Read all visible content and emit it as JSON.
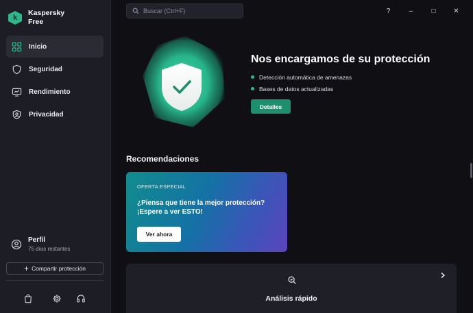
{
  "app": {
    "name": "Kaspersky Free",
    "logo_letter": "k",
    "brand_color": "#2fb68a"
  },
  "search": {
    "placeholder": "Buscar (Ctrl+F)"
  },
  "window_controls": {
    "help": "?",
    "minimize": "–",
    "maximize": "□",
    "close": "✕"
  },
  "sidebar": {
    "items": [
      {
        "label": "Inicio",
        "icon": "grid-icon",
        "active": true
      },
      {
        "label": "Seguridad",
        "icon": "shield-icon",
        "active": false
      },
      {
        "label": "Rendimiento",
        "icon": "monitor-icon",
        "active": false
      },
      {
        "label": "Privacidad",
        "icon": "privacy-shield-icon",
        "active": false
      }
    ],
    "profile": {
      "name": "Perfil",
      "subtitle": "75 días restantes"
    },
    "share_button": "Compartir protección",
    "bottom_icons": [
      "shopping-bag-icon",
      "gear-icon",
      "headset-icon"
    ]
  },
  "hero": {
    "title": "Nos encargamos de su protección",
    "bullets": [
      "Detección automática de amenazas",
      "Bases de datos actualizadas"
    ],
    "button": "Detalles"
  },
  "recommendations": {
    "title": "Recomendaciones",
    "promo": {
      "tag": "OFERTA ESPECIAL",
      "headline": "¿Piensa que tiene la mejor protección? ¡Espere a ver ESTO!",
      "button": "Ver ahora"
    }
  },
  "quick_scan": {
    "label": "Análisis rápido"
  }
}
